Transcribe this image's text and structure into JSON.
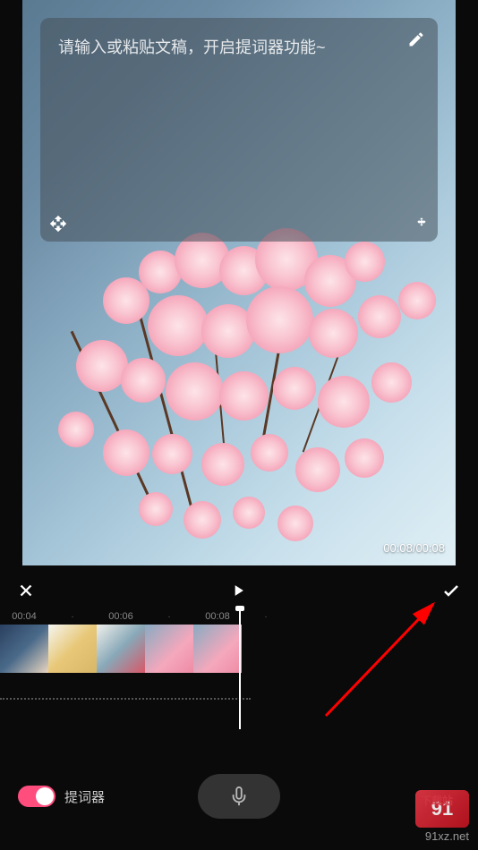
{
  "teleprompter": {
    "placeholder": "请输入或粘贴文稿，开启提词器功能~"
  },
  "preview": {
    "time_display": "00:08/00:08"
  },
  "timeline": {
    "ticks": [
      "00:04",
      "00:06",
      "00:08"
    ]
  },
  "bottom": {
    "toggle_label": "提词器",
    "toggle_on": true
  },
  "watermark": {
    "logo_text": "91",
    "label": "下载站",
    "url": "91xz.net"
  }
}
